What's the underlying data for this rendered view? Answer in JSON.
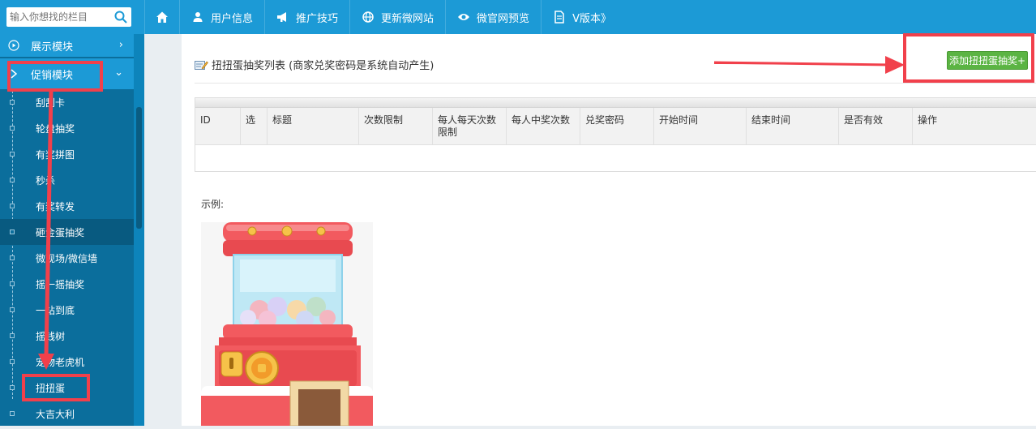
{
  "search": {
    "placeholder": "输入你想找的栏目"
  },
  "nav": [
    {
      "label": "",
      "icon": "home-icon"
    },
    {
      "label": "用户信息",
      "icon": "user-icon"
    },
    {
      "label": "推广技巧",
      "icon": "megaphone-icon"
    },
    {
      "label": "更新微网站",
      "icon": "globe-icon"
    },
    {
      "label": "微官网预览",
      "icon": "eye-icon"
    },
    {
      "label": "V版本》",
      "icon": "document-icon"
    }
  ],
  "sidebar": {
    "sections": [
      {
        "label": "展示模块",
        "chevron": "›"
      },
      {
        "label": "促销模块",
        "chevron": "⌄"
      }
    ],
    "items": [
      {
        "label": "刮刮卡"
      },
      {
        "label": "轮盘抽奖"
      },
      {
        "label": "有奖拼图"
      },
      {
        "label": "秒杀"
      },
      {
        "label": "有奖转发"
      },
      {
        "label": "砸金蛋抽奖"
      },
      {
        "label": "微现场/微信墙"
      },
      {
        "label": "摇一摇抽奖"
      },
      {
        "label": "一站到底"
      },
      {
        "label": "摇钱树"
      },
      {
        "label": "宠物老虎机"
      },
      {
        "label": "扭扭蛋"
      },
      {
        "label": "大吉大利"
      }
    ]
  },
  "main": {
    "title": "扭扭蛋抽奖列表 (商家兑奖密码是系统自动产生)",
    "add_button": "添加扭扭蛋抽奖+",
    "table": {
      "headers": [
        "ID",
        "选",
        "标题",
        "次数限制",
        "每人每天次数限制",
        "每人中奖次数",
        "兑奖密码",
        "开始时间",
        "结束时间",
        "是否有效",
        "操作"
      ]
    },
    "example_label": "示例:"
  },
  "colors": {
    "topbar": "#1c9ad6",
    "sidebar": "#0b6e9c",
    "button": "#5bb443",
    "annotation": "#f1404b"
  }
}
